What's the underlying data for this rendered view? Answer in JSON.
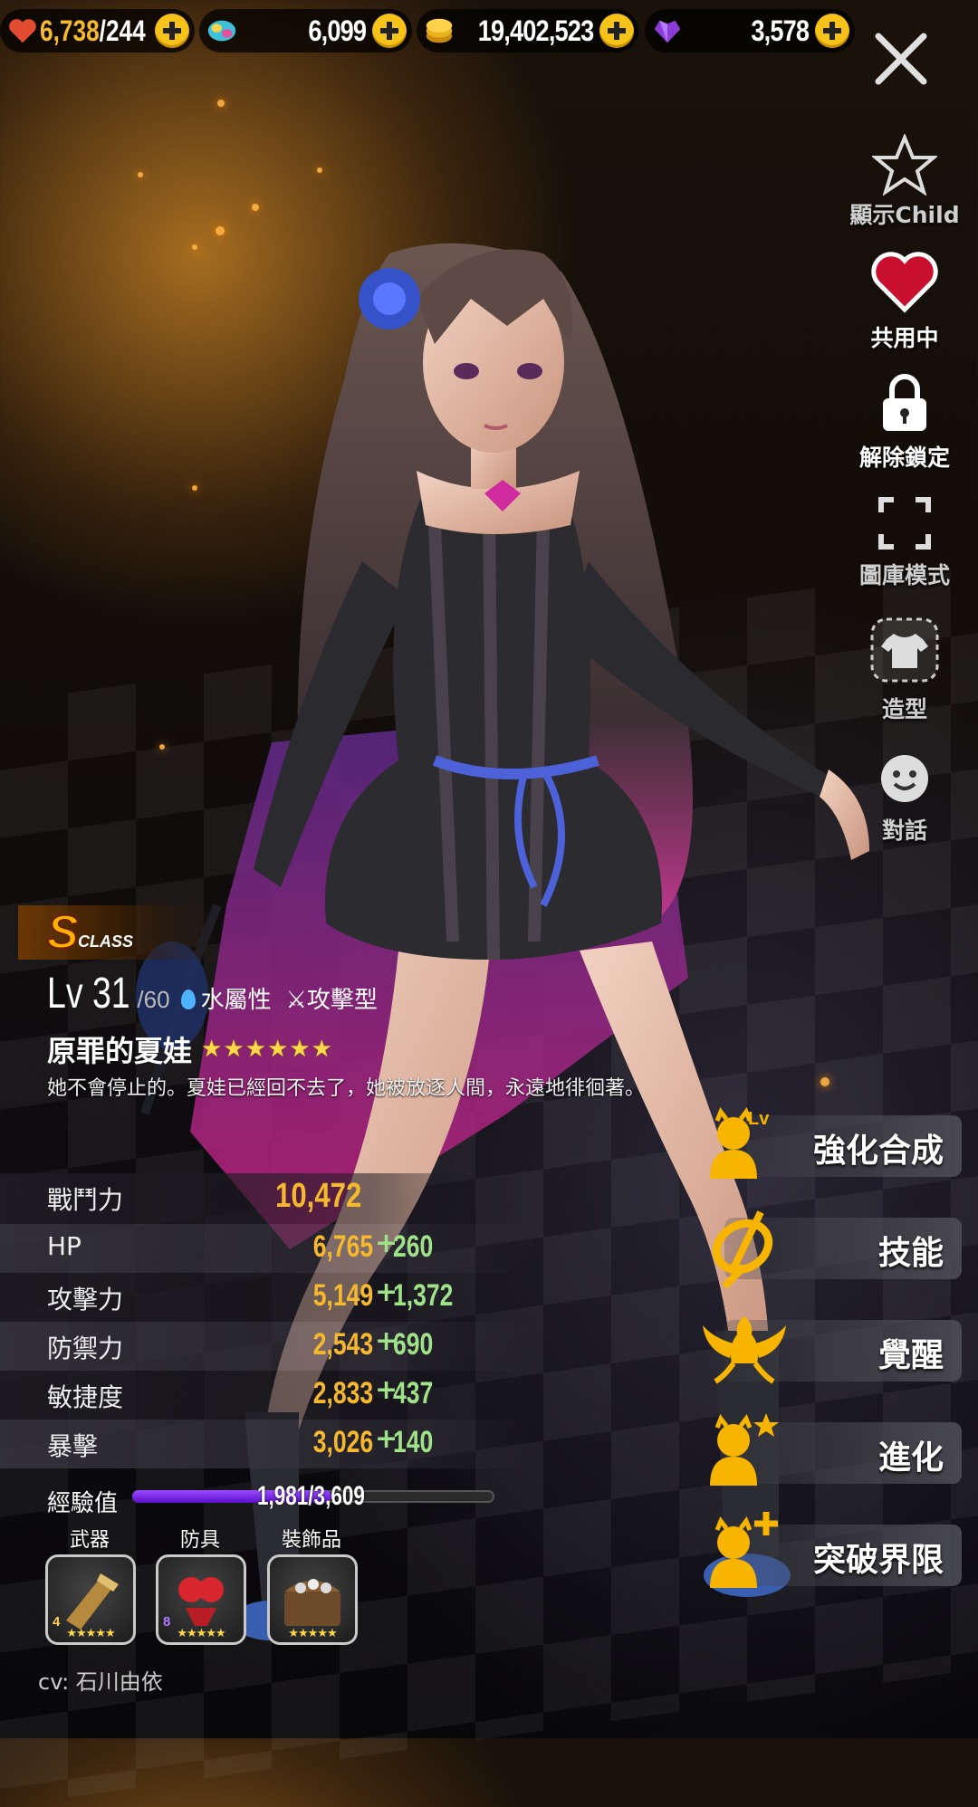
{
  "resources": [
    {
      "icon": "stamina-heart-icon",
      "value": "6,738",
      "max": "244"
    },
    {
      "icon": "rainbow-gem-icon",
      "value": "6,099"
    },
    {
      "icon": "gold-coin-icon",
      "value": "19,402,523"
    },
    {
      "icon": "purple-heart-gem-icon",
      "value": "3,578"
    }
  ],
  "side_menu": {
    "show_child": "顯示Child",
    "shared": "共用中",
    "unlock": "解除鎖定",
    "gallery": "圖庫模式",
    "outfit": "造型",
    "dialogue": "對話"
  },
  "character": {
    "class_letter": "S",
    "class_text": "CLASS",
    "level": "Lv 31",
    "level_max": "/60",
    "attribute": "水屬性",
    "type": "⚔攻擊型",
    "name": "原罪的夏娃",
    "stars": 6,
    "description": "她不會停止的。夏娃已經回不去了，她被放逐人間，永遠地徘徊著。"
  },
  "stats": {
    "power_label": "戰鬥力",
    "power_value": "10,472",
    "rows": [
      {
        "name": "HP",
        "base": "6,765",
        "bonus": "260"
      },
      {
        "name": "攻擊力",
        "base": "5,149",
        "bonus": "1,372"
      },
      {
        "name": "防禦力",
        "base": "2,543",
        "bonus": "690"
      },
      {
        "name": "敏捷度",
        "base": "2,833",
        "bonus": "437"
      },
      {
        "name": "暴擊",
        "base": "3,026",
        "bonus": "140"
      }
    ]
  },
  "exp": {
    "label": "經驗值",
    "text": "1,981/3,609",
    "fraction": 0.549
  },
  "equipment": [
    {
      "label": "武器",
      "level": "4",
      "stars": "★★★★★"
    },
    {
      "label": "防具",
      "level": "8",
      "stars": "★★★★★"
    },
    {
      "label": "裝飾品",
      "level": "",
      "stars": "★★★★★"
    }
  ],
  "actions": [
    {
      "label": "強化合成",
      "icon": "enhance-fusion-icon"
    },
    {
      "label": "技能",
      "icon": "skill-icon"
    },
    {
      "label": "覺醒",
      "icon": "awaken-icon"
    },
    {
      "label": "進化",
      "icon": "evolve-icon"
    },
    {
      "label": "突破界限",
      "icon": "limit-break-icon"
    }
  ],
  "action_small": {
    "lv": "Lv"
  },
  "cv": "cv: 石川由依",
  "colors": {
    "gold": "#f5b82e",
    "bonus_green": "#9fe28a",
    "exp_purple": "#7a2be8",
    "plus_yellow": "#f7c21a"
  }
}
